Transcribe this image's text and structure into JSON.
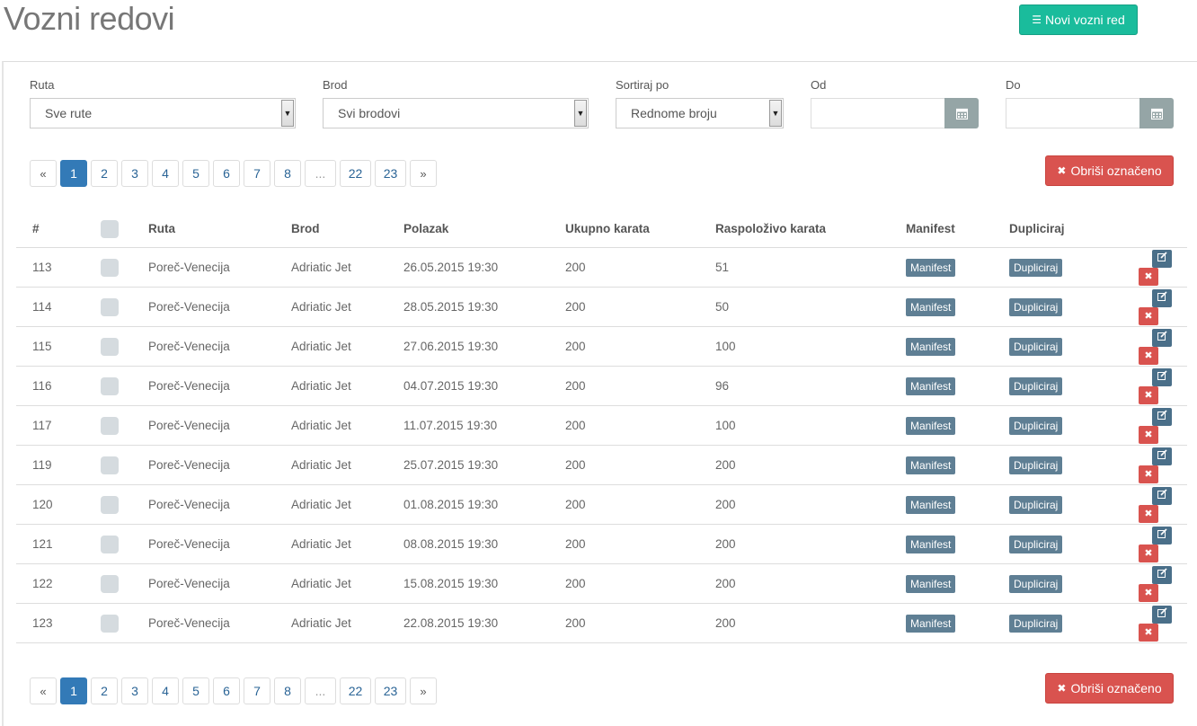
{
  "page": {
    "title": "Vozni redovi"
  },
  "header": {
    "new_button_label": "Novi vozni red"
  },
  "filters": {
    "ruta": {
      "label": "Ruta",
      "value": "Sve rute"
    },
    "brod": {
      "label": "Brod",
      "value": "Svi brodovi"
    },
    "sort": {
      "label": "Sortiraj po",
      "value": "Rednome broju"
    },
    "od": {
      "label": "Od",
      "value": ""
    },
    "do": {
      "label": "Do",
      "value": ""
    }
  },
  "pagination": {
    "prev": "«",
    "next": "»",
    "pages": [
      "1",
      "2",
      "3",
      "4",
      "5",
      "6",
      "7",
      "8",
      "...",
      "22",
      "23"
    ],
    "active": "1"
  },
  "delete_selected_label": "Obriši označeno",
  "table": {
    "headers": {
      "num": "#",
      "ruta": "Ruta",
      "brod": "Brod",
      "polazak": "Polazak",
      "ukupno": "Ukupno karata",
      "raspolozivo": "Raspoloživo karata",
      "manifest": "Manifest",
      "dupliciraj": "Dupliciraj"
    },
    "manifest_label": "Manifest",
    "dupliciraj_label": "Dupliciraj",
    "rows": [
      {
        "id": "113",
        "ruta": "Poreč-Venecija",
        "brod": "Adriatic Jet",
        "polazak": "26.05.2015 19:30",
        "ukupno": "200",
        "raspolozivo": "51"
      },
      {
        "id": "114",
        "ruta": "Poreč-Venecija",
        "brod": "Adriatic Jet",
        "polazak": "28.05.2015 19:30",
        "ukupno": "200",
        "raspolozivo": "50"
      },
      {
        "id": "115",
        "ruta": "Poreč-Venecija",
        "brod": "Adriatic Jet",
        "polazak": "27.06.2015 19:30",
        "ukupno": "200",
        "raspolozivo": "100"
      },
      {
        "id": "116",
        "ruta": "Poreč-Venecija",
        "brod": "Adriatic Jet",
        "polazak": "04.07.2015 19:30",
        "ukupno": "200",
        "raspolozivo": "96"
      },
      {
        "id": "117",
        "ruta": "Poreč-Venecija",
        "brod": "Adriatic Jet",
        "polazak": "11.07.2015 19:30",
        "ukupno": "200",
        "raspolozivo": "100"
      },
      {
        "id": "119",
        "ruta": "Poreč-Venecija",
        "brod": "Adriatic Jet",
        "polazak": "25.07.2015 19:30",
        "ukupno": "200",
        "raspolozivo": "200"
      },
      {
        "id": "120",
        "ruta": "Poreč-Venecija",
        "brod": "Adriatic Jet",
        "polazak": "01.08.2015 19:30",
        "ukupno": "200",
        "raspolozivo": "200"
      },
      {
        "id": "121",
        "ruta": "Poreč-Venecija",
        "brod": "Adriatic Jet",
        "polazak": "08.08.2015 19:30",
        "ukupno": "200",
        "raspolozivo": "200"
      },
      {
        "id": "122",
        "ruta": "Poreč-Venecija",
        "brod": "Adriatic Jet",
        "polazak": "15.08.2015 19:30",
        "ukupno": "200",
        "raspolozivo": "200"
      },
      {
        "id": "123",
        "ruta": "Poreč-Venecija",
        "brod": "Adriatic Jet",
        "polazak": "22.08.2015 19:30",
        "ukupno": "200",
        "raspolozivo": "200"
      }
    ]
  },
  "colors": {
    "accent": "#1abc9c",
    "danger": "#d9534f",
    "primary": "#337ab7",
    "muted_button": "#5f7f94"
  }
}
